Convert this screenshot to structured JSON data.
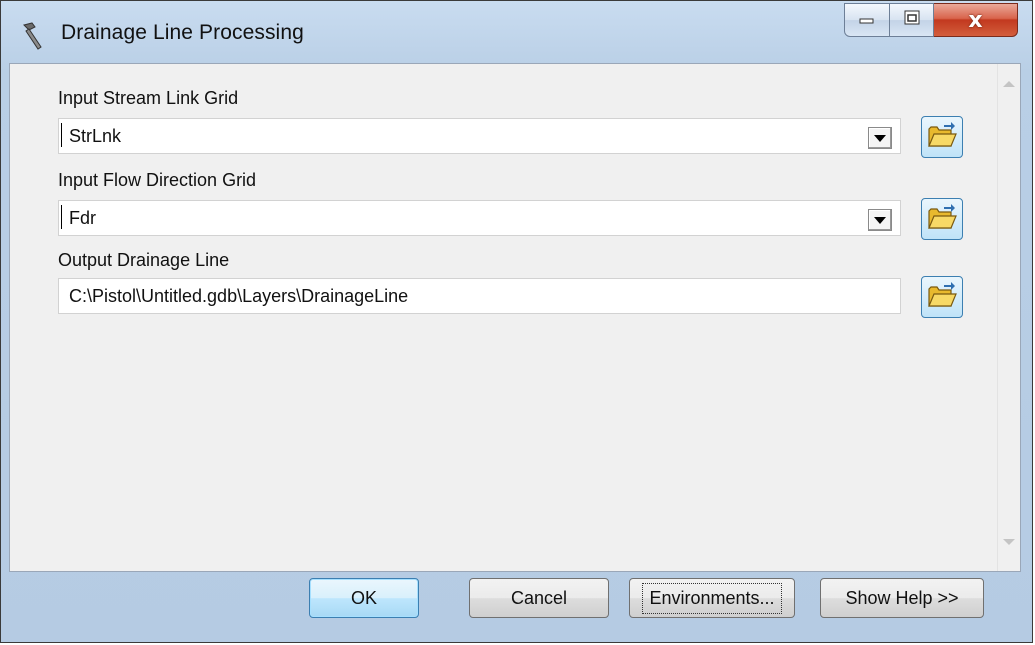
{
  "window": {
    "title": "Drainage Line Processing",
    "icons": {
      "app": "hammer-icon",
      "minimize": "minimize-icon",
      "maximize": "maximize-icon",
      "close": "close-icon"
    },
    "close_glyph": "x"
  },
  "form": {
    "fields": [
      {
        "label": "Input Stream Link Grid",
        "value": "StrLnk",
        "kind": "combo"
      },
      {
        "label": "Input Flow Direction Grid",
        "value": "Fdr",
        "kind": "combo"
      },
      {
        "label": "Output Drainage Line",
        "value": "C:\\Pistol\\Untitled.gdb\\Layers\\DrainageLine",
        "kind": "text"
      }
    ],
    "browse_icon": "open-folder-icon"
  },
  "buttons": {
    "ok": "OK",
    "cancel": "Cancel",
    "environments": "Environments...",
    "show_help": "Show Help >>"
  },
  "colors": {
    "frame": "#b9cfe6",
    "client": "#f0f0f0",
    "close_button": "#c2391f",
    "default_button_border": "#3c7fb1"
  }
}
